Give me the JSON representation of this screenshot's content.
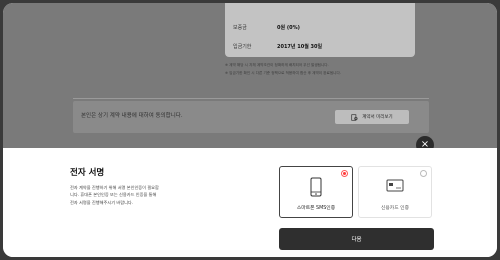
{
  "background": {
    "rows": [
      {
        "label": "보증금",
        "value": "0원 (0%)"
      },
      {
        "label": "입금기한",
        "value": "2017년 10월 30일"
      }
    ],
    "notes": [
      "※ 계약 해당 시 자체 계약조건이 정확하게 배치되어 우선 발생됩니다.",
      "※ 입금기한 확인 시 다른 기준 정책으로 적용하여 합산 후 계약이 완료됩니다."
    ],
    "agreement_text": "본인은 상기 계약 내용에 대하여 동의합니다.",
    "contract_preview_label": "계약서 미리보기"
  },
  "modal": {
    "close_label": "×",
    "title": "전자 서명",
    "description": "전자 계약을 진행하기 위해 서명 본인인증이 필요합니다. 휴대폰 본인인증 또는 신용카드 인증을 통해 전자 서명을 진행해주시기 바랍니다.",
    "options": [
      {
        "label": "스마트폰 SMS인증",
        "icon": "smartphone-icon",
        "selected": true
      },
      {
        "label": "신용카드 인증",
        "icon": "credit-card-icon",
        "selected": false
      }
    ],
    "next_label": "다음"
  },
  "colors": {
    "accent_red": "#ff3b3b",
    "button_dark": "#2f2f2f",
    "overlay": "#7a7a7a"
  }
}
